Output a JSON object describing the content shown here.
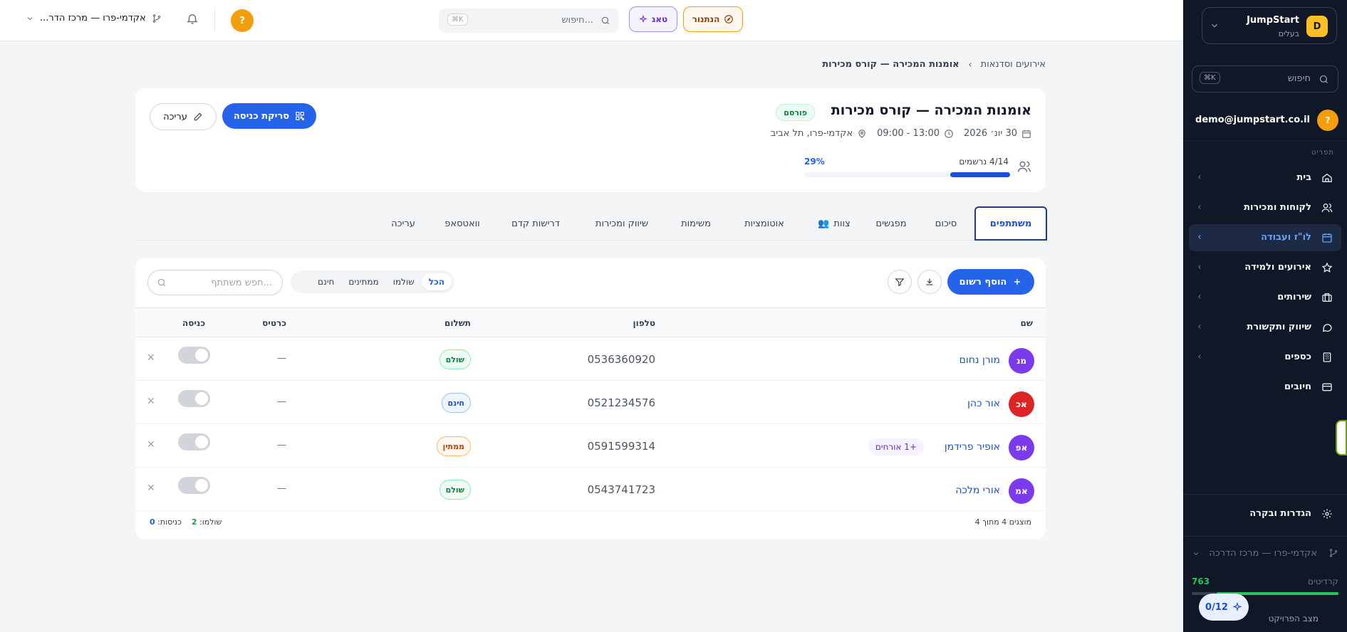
{
  "sidebar": {
    "brand": {
      "logo_letter": "D",
      "name": "JumpStart",
      "role": "בעלים"
    },
    "search": {
      "placeholder": "חיפוש",
      "shortcut": "⌘K"
    },
    "user": {
      "avatar": "?",
      "email": "demo@jumpstart.co.il"
    },
    "section_label": "תפריט",
    "items": [
      {
        "label": "בית",
        "icon": "home-icon"
      },
      {
        "label": "לקוחות ומכירות",
        "icon": "users-icon"
      },
      {
        "label": "לו\"ז ועבודה",
        "icon": "calendar-icon",
        "active": true
      },
      {
        "label": "אירועים ולמידה",
        "icon": "star-icon"
      },
      {
        "label": "שירותים",
        "icon": "briefcase-icon"
      },
      {
        "label": "שיווק ותקשורת",
        "icon": "chat-icon"
      },
      {
        "label": "כספים",
        "icon": "building-icon"
      },
      {
        "label": "חיובים",
        "icon": "card-icon"
      }
    ],
    "settings_label": "הגדרות ובקרה",
    "org_label": "אקדמי-פרו — מרכז הדרכה",
    "credits": {
      "label": "קרדיטים",
      "value": "763",
      "fill_fraction": 0.83
    },
    "tasks_pill": "0/12",
    "project_label": "מצב הפרויקט"
  },
  "topbar": {
    "search_placeholder": "חיפוש...",
    "search_shortcut": "⌘K",
    "navigator_label": "הנתנור",
    "tag_label": "טאג",
    "help_avatar": "?",
    "org_label": "אקדמי-פרו — מרכז הדר..."
  },
  "breadcrumb": {
    "parent": "אירועים וסדנאות",
    "current": "אומנות המכירה — קורס מכירות"
  },
  "event": {
    "title": "אומנות המכירה — קורס מכירות",
    "status": "פורסם",
    "date": "30 יונ׳ 2026",
    "time": "09:00 - 13:00",
    "location": "אקדמי-פרו, תל אביב",
    "registrations": "4/14 נרשמים",
    "percent_label": "29%",
    "fill_fraction": 0.29,
    "scan_label": "סריקת כניסה",
    "edit_label": "עריכה"
  },
  "tabs": [
    {
      "label": "משתתפים",
      "active": true
    },
    {
      "label": "סיכום"
    },
    {
      "label": "מפגשים"
    },
    {
      "label": "צוות"
    },
    {
      "label": "אוטומציות"
    },
    {
      "label": "משימות"
    },
    {
      "label": "שיווק ומכירות"
    },
    {
      "label": "דרישות קדם"
    },
    {
      "label": "וואטסאפ"
    },
    {
      "label": "עריכה"
    }
  ],
  "participants": {
    "add_label": "הוסף רשום",
    "filters": [
      "הכל",
      "שולמו",
      "ממתינים",
      "חינם"
    ],
    "search_placeholder": "חפש משתתף...",
    "columns": {
      "name": "שם",
      "phone": "טלפון",
      "payment": "תשלום",
      "ticket": "כרטיס",
      "checkin": "כניסה"
    },
    "rows": [
      {
        "initials": "מנ",
        "color": "#7c3aed",
        "name": "מורן נחום",
        "guests": "",
        "phone": "0536360920",
        "payment": "שולם",
        "ticket": "—"
      },
      {
        "initials": "אכ",
        "color": "#dc2626",
        "name": "אור כהן",
        "guests": "",
        "phone": "0521234576",
        "payment": "חינם",
        "ticket": "—"
      },
      {
        "initials": "אפ",
        "color": "#7c3aed",
        "name": "אופיר פרידמן",
        "guests": "+1 אורחים",
        "phone": "0591599314",
        "payment": "ממתין",
        "ticket": "—"
      },
      {
        "initials": "אמ",
        "color": "#7c3aed",
        "name": "אורי מלכה",
        "guests": "",
        "phone": "0543741723",
        "payment": "שולם",
        "ticket": "—"
      }
    ],
    "footer": {
      "shown": "מוצגים 4 מתוך 4",
      "paid_label": "שולמו:",
      "paid_value": "2",
      "checkins_label": "כניסות:",
      "checkins_value": "0"
    }
  },
  "colors": {
    "primary": "#2563eb",
    "sidebar_bg": "#101827",
    "accent_amber": "#f59e0b"
  }
}
